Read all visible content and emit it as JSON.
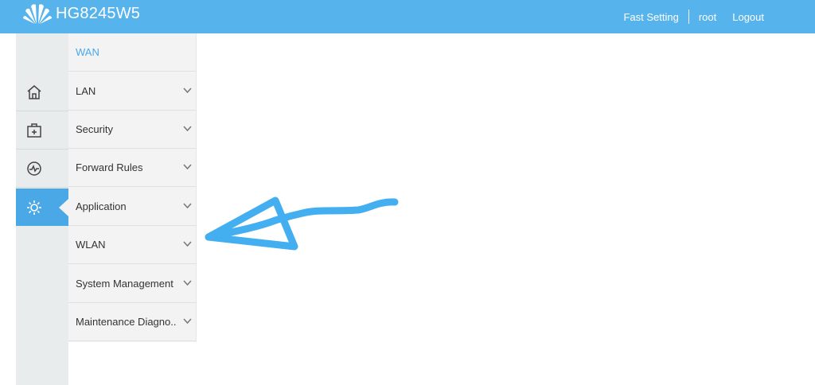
{
  "header": {
    "model": "HG8245W5",
    "fast_setting": "Fast Setting",
    "user": "root",
    "logout": "Logout"
  },
  "rail": [
    {
      "icon": "home-icon"
    },
    {
      "icon": "tools-box-icon"
    },
    {
      "icon": "diagnostics-icon"
    },
    {
      "icon": "gear-icon",
      "active": true
    }
  ],
  "menu": {
    "items": [
      {
        "label": "WAN"
      },
      {
        "label": "LAN"
      },
      {
        "label": "Security"
      },
      {
        "label": "Forward Rules"
      },
      {
        "label": "Application"
      },
      {
        "label": "WLAN"
      },
      {
        "label": "System Management"
      },
      {
        "label": "Maintenance Diagno.."
      }
    ]
  },
  "colors": {
    "topbar": "#57b3eb",
    "accent": "#4aa8e6",
    "rail_bg": "#e9ecec",
    "menu_bg": "#f3f3f3",
    "annotation": "#43aef0"
  },
  "annotation": {
    "icon": "hand-drawn-arrow-annotation"
  }
}
